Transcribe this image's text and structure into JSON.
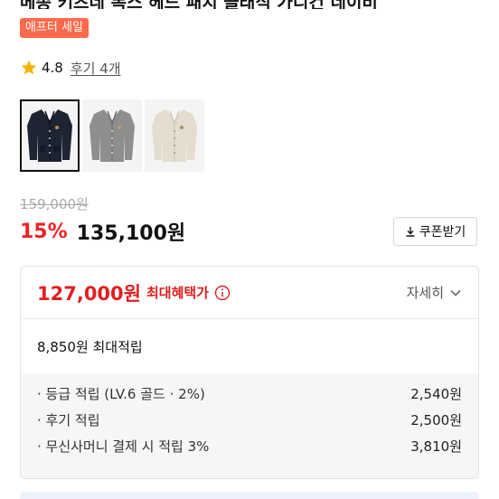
{
  "header": {
    "title_partial": "메종 키츠네 폭스 헤드 패치 클래식 가디건 네이비"
  },
  "badge": {
    "label": "애프터 세일"
  },
  "rating": {
    "score": "4.8",
    "review_link": "후기 4개"
  },
  "thumbnails": [
    {
      "color": "navy",
      "selected": true
    },
    {
      "color": "gray",
      "selected": false
    },
    {
      "color": "beige",
      "selected": false
    }
  ],
  "price": {
    "original": "159,000원",
    "discount": "15%",
    "final": "135,100원",
    "coupon_label": "쿠폰받기"
  },
  "benefit": {
    "max_price": "127,000원",
    "max_label": "최대혜택가",
    "detail_label": "자세히",
    "max_points": "8,850원 최대적립",
    "rows": [
      {
        "label": "· 등급 적립 (LV.6 골드 · 2%)",
        "value": "2,540원"
      },
      {
        "label": "· 후기 적립",
        "value": "2,500원"
      },
      {
        "label": "· 무신사머니 결제 시 적립 3%",
        "value": "3,810원"
      }
    ]
  },
  "colors": {
    "accent_red": "#e01f1f",
    "discount_red": "#f02222",
    "badge_orange": "#ff6a4a",
    "star_yellow": "#f5b400"
  }
}
